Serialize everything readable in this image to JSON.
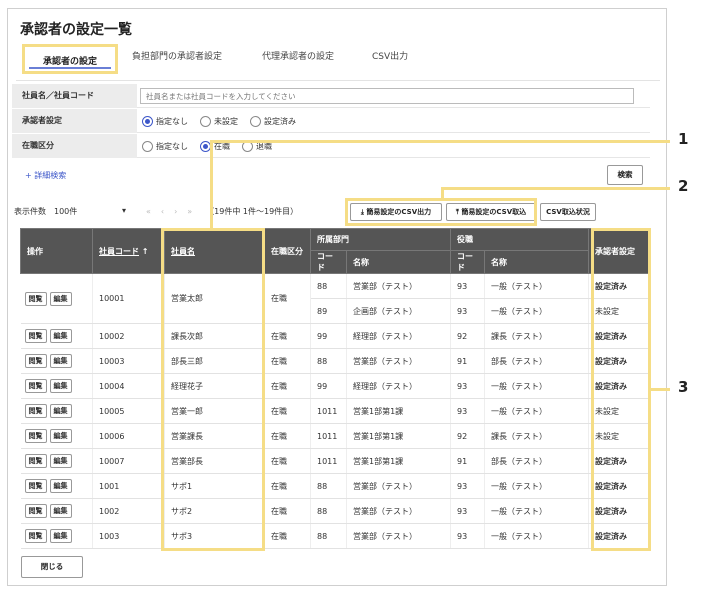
{
  "page": {
    "title": "承認者の設定一覧"
  },
  "tabs": [
    "承認者の設定",
    "負担部門の承認者設定",
    "代理承認者の設定",
    "CSV出力"
  ],
  "form": {
    "employee_label": "社員名／社員コード",
    "employee_placeholder": "社員名または社員コードを入力してください",
    "approver_label": "承認者設定",
    "approver_options": [
      "指定なし",
      "未設定",
      "設定済み"
    ],
    "status_label": "在職区分",
    "status_options": [
      "指定なし",
      "在職",
      "退職"
    ],
    "advanced": "+ 詳細検索",
    "search": "検索"
  },
  "pager": {
    "count_label": "表示件数",
    "count_value": "100件",
    "range": "（19件中 1件〜19件目）"
  },
  "buttons": {
    "csv_export": "簡易設定のCSV出力",
    "csv_import": "簡易設定のCSV取込",
    "csv_status": "CSV取込状況",
    "view": "閲覧",
    "edit": "編集",
    "close": "閉じる"
  },
  "table": {
    "headers": {
      "ops": "操作",
      "code": "社員コード",
      "sort_arrow": "↑",
      "name": "社員名",
      "status": "在職区分",
      "dept": "所属部門",
      "post": "役職",
      "sub_code": "コード",
      "sub_name": "名称",
      "approver": "承認者設定"
    },
    "rows": [
      {
        "code": "10001",
        "name": "営業太郎",
        "status": "在職",
        "d_code": "88",
        "d_name": "営業部（テスト）",
        "p_code": "93",
        "p_name": "一般（テスト）",
        "setting": "設定済み"
      },
      {
        "code": "",
        "name": "",
        "status": "",
        "d_code": "89",
        "d_name": "企画部（テスト）",
        "p_code": "93",
        "p_name": "一般（テスト）",
        "setting": "未設定"
      },
      {
        "code": "10002",
        "name": "課長次郎",
        "status": "在職",
        "d_code": "99",
        "d_name": "経理部（テスト）",
        "p_code": "92",
        "p_name": "課長（テスト）",
        "setting": "設定済み"
      },
      {
        "code": "10003",
        "name": "部長三郎",
        "status": "在職",
        "d_code": "88",
        "d_name": "営業部（テスト）",
        "p_code": "91",
        "p_name": "部長（テスト）",
        "setting": "設定済み"
      },
      {
        "code": "10004",
        "name": "経理花子",
        "status": "在職",
        "d_code": "99",
        "d_name": "経理部（テスト）",
        "p_code": "93",
        "p_name": "一般（テスト）",
        "setting": "設定済み"
      },
      {
        "code": "10005",
        "name": "営業一郎",
        "status": "在職",
        "d_code": "1011",
        "d_name": "営業1部第1課",
        "p_code": "93",
        "p_name": "一般（テスト）",
        "setting": "未設定"
      },
      {
        "code": "10006",
        "name": "営業課長",
        "status": "在職",
        "d_code": "1011",
        "d_name": "営業1部第1課",
        "p_code": "92",
        "p_name": "課長（テスト）",
        "setting": "未設定"
      },
      {
        "code": "10007",
        "name": "営業部長",
        "status": "在職",
        "d_code": "1011",
        "d_name": "営業1部第1課",
        "p_code": "91",
        "p_name": "部長（テスト）",
        "setting": "設定済み"
      },
      {
        "code": "1001",
        "name": "サポ1",
        "status": "在職",
        "d_code": "88",
        "d_name": "営業部（テスト）",
        "p_code": "93",
        "p_name": "一般（テスト）",
        "setting": "設定済み"
      },
      {
        "code": "1002",
        "name": "サポ2",
        "status": "在職",
        "d_code": "88",
        "d_name": "営業部（テスト）",
        "p_code": "93",
        "p_name": "一般（テスト）",
        "setting": "設定済み"
      },
      {
        "code": "1003",
        "name": "サポ3",
        "status": "在職",
        "d_code": "88",
        "d_name": "営業部（テスト）",
        "p_code": "93",
        "p_name": "一般（テスト）",
        "setting": "設定済み"
      }
    ]
  },
  "callouts": [
    "1",
    "2",
    "3"
  ],
  "colors": {
    "highlight": "#f5dd86",
    "header": "#555555",
    "unset": "#d1232a",
    "accent": "#3d57c9"
  }
}
